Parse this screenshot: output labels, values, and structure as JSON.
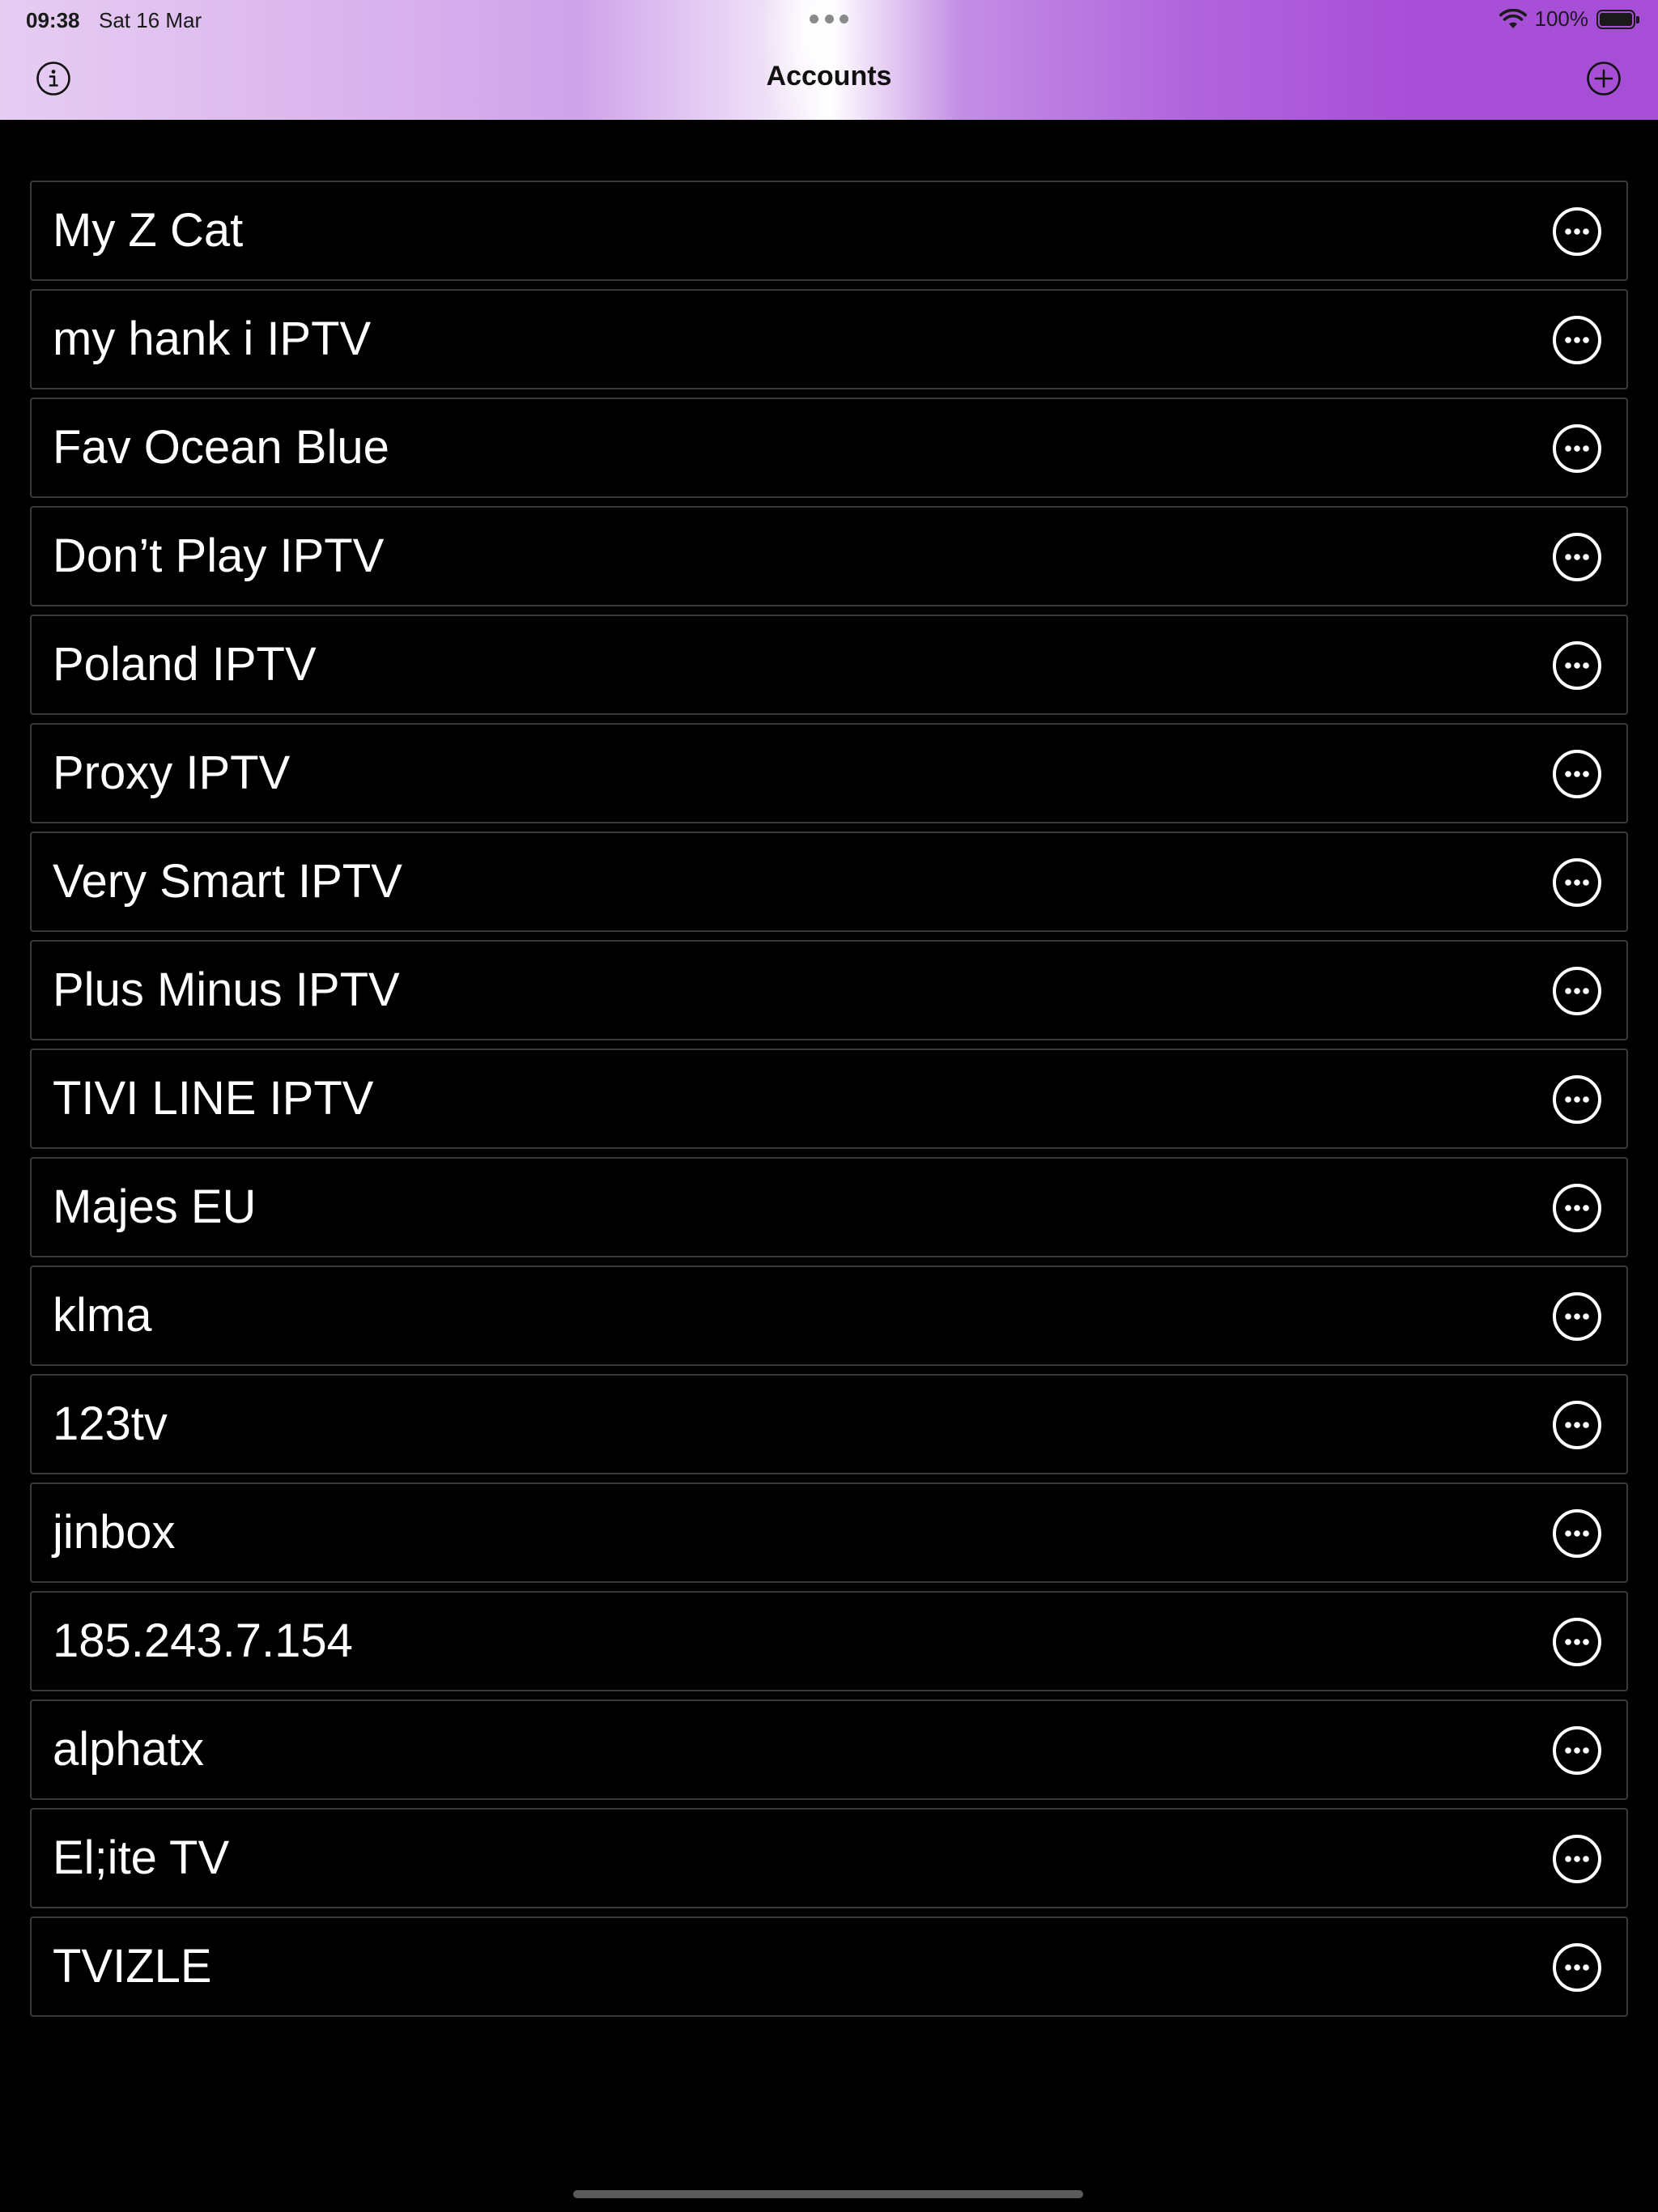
{
  "status_bar": {
    "time": "09:38",
    "date": "Sat 16 Mar",
    "battery": "100%",
    "wifi_icon": "wifi-icon",
    "battery_icon": "battery-full-icon"
  },
  "nav": {
    "title": "Accounts",
    "left_icon": "info-icon",
    "right_icon": "add-circle-icon"
  },
  "accounts": [
    {
      "name": "My Z Cat"
    },
    {
      "name": "my hank i IPTV"
    },
    {
      "name": "Fav Ocean Blue"
    },
    {
      "name": "Don’t Play IPTV"
    },
    {
      "name": "Poland IPTV"
    },
    {
      "name": "Proxy IPTV"
    },
    {
      "name": "Very Smart IPTV"
    },
    {
      "name": "Plus Minus IPTV"
    },
    {
      "name": "TIVI LINE IPTV"
    },
    {
      "name": "Majes EU"
    },
    {
      "name": "klma"
    },
    {
      "name": "123tv"
    },
    {
      "name": "jinbox"
    },
    {
      "name": "185.243.7.154"
    },
    {
      "name": "alphatx"
    },
    {
      "name": "El;ite TV"
    },
    {
      "name": "TVIZLE"
    }
  ],
  "row_action_icon": "more-ellipsis-circle-icon",
  "colors": {
    "background": "#000000",
    "row_border": "#3a3a3c",
    "header_purple": "#a84fd8",
    "text": "#ffffff"
  }
}
